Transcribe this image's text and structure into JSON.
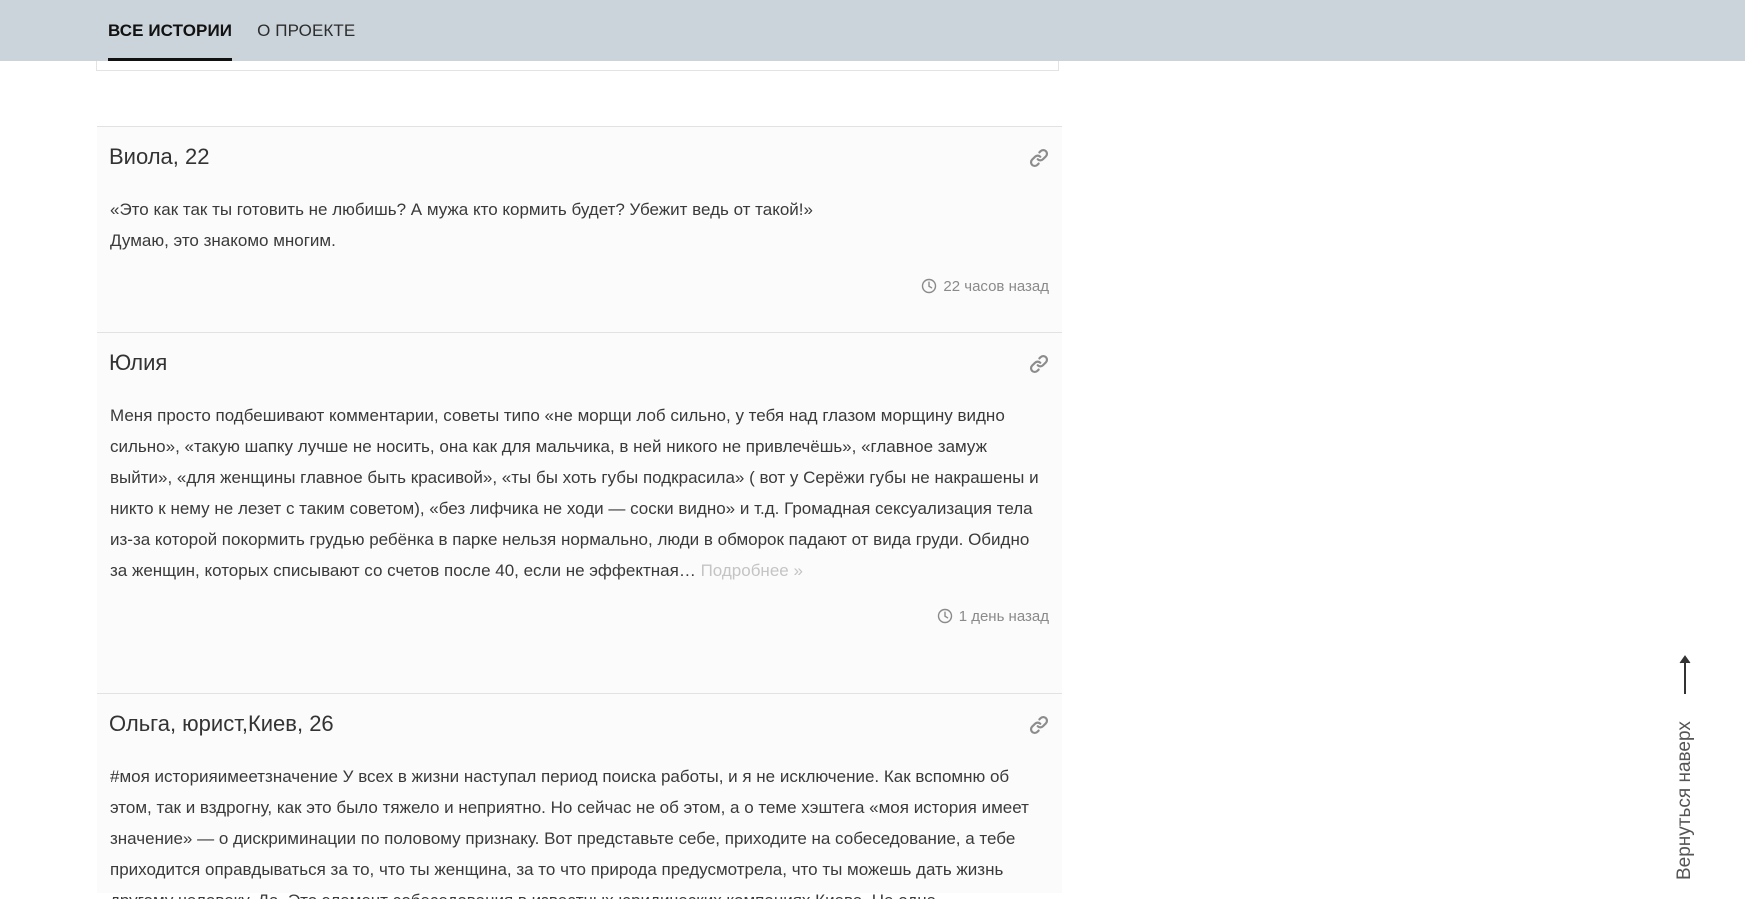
{
  "nav": {
    "items": [
      {
        "label": "ВСЕ ИСТОРИИ",
        "active": true
      },
      {
        "label": "О ПРОЕКТЕ",
        "active": false
      }
    ]
  },
  "stories": [
    {
      "title": "Виола, 22",
      "text": "«Это как так ты готовить не любишь? А мужа кто кормить будет? Убежит ведь от такой!»\nДумаю, это знакомо многим.",
      "more": "",
      "time": "22 часов назад"
    },
    {
      "title": "Юлия",
      "text": "Меня просто подбешивают комментарии, советы типо «не морщи лоб сильно, у тебя над глазом морщину видно сильно», «такую шапку лучше не носить, она как для мальчика, в ней никого не привлечёшь», «главное замуж выйти», «для женщины главное быть красивой», «ты бы хоть губы подкрасила» ( вот у Серёжи губы не накрашены и никто к нему не лезет с таким советом), «без лифчика не ходи — соски видно» и т.д. Громадная сексуализация тела из-за которой покормить грудью ребёнка в парке нельзя нормально, люди в обморок падают от вида груди. Обидно за женщин, которых списывают со счетов после 40, если не эффектная…",
      "more": "Подробнее »",
      "time": "1 день назад"
    },
    {
      "title": "Ольга, юрист,Киев, 26",
      "text": "#моя историяимеетзначение У всех в жизни наступал период поиска работы, и я не исключение. Как вспомню об этом, так и вздрогну, как это было тяжело и неприятно. Но сейчас не об этом, а о теме хэштега «моя история имеет значение» — о дискриминации по половому признаку. Вот представьте себе, приходите на собеседование, а тебе приходится оправдываться за то, что ты женщина, за то что природа предусмотрела, что ты можешь дать жизнь другому человеку. Да. Это элемент собеседования в известных юридических компаниях Киева. Не одна",
      "more": "",
      "time": ""
    }
  ],
  "back_to_top": {
    "label": "Вернуться наверх"
  }
}
